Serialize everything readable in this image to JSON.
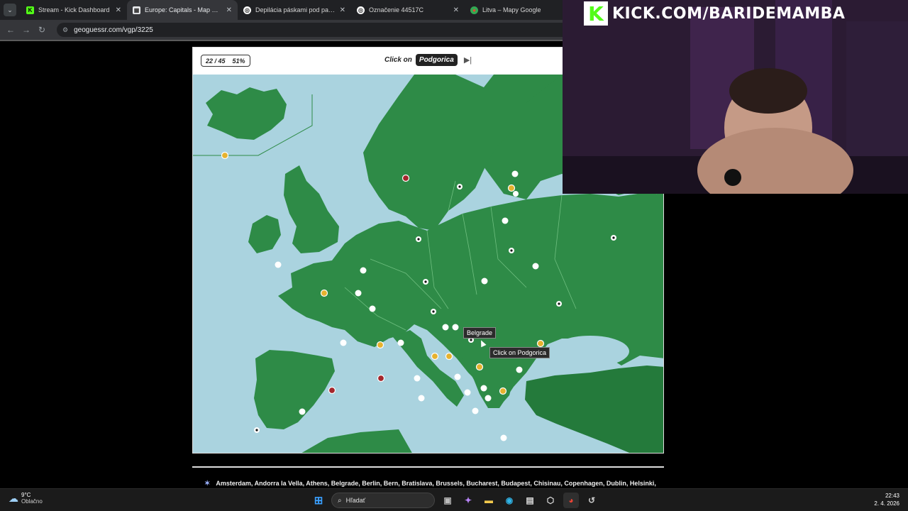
{
  "browser": {
    "tabs": [
      {
        "label": "Stream - Kick Dashboard",
        "close": "✕",
        "active": false
      },
      {
        "label": "Europe: Capitals - Map Quiz Ga",
        "close": "✕",
        "active": true
      },
      {
        "label": "Depilácia páskami pod pazuchy",
        "close": "✕",
        "active": false
      },
      {
        "label": "Označenie 44517C",
        "close": "✕",
        "active": false
      },
      {
        "label": "Litva – Mapy Google",
        "close": "",
        "active": false
      }
    ],
    "url": "geoguessr.com/vgp/3225"
  },
  "game": {
    "progress": "22 / 45",
    "percent": "51%",
    "click_on_label": "Click on",
    "target": "Podgorica",
    "hover_label": "Belgrade",
    "cursor_tooltip": "Click on Podgorica",
    "answers": "Amsterdam, Andorra la Vella, Athens, Belgrade, Berlin, Bern, Bratislava, Brussels, Bucharest, Budapest, Chisinau, Copenhagen, Dublin, Helsinki,",
    "colors": {
      "sea": "#aad3df",
      "land": "#2e8b47",
      "land_dark": "#247a3b",
      "border": "#6fbf80",
      "marker_white": "#ffffff",
      "marker_yellow": "#e6b22e",
      "marker_red": "#a4262c"
    }
  },
  "overlay": {
    "channel": "KICK.COM/BARIDEMAMBA",
    "logo_letter": "K"
  },
  "taskbar": {
    "temperature": "9°C",
    "condition": "Oblačno",
    "search_label": "Hľadať",
    "time": "22:43",
    "date": "2. 4. 2026"
  }
}
